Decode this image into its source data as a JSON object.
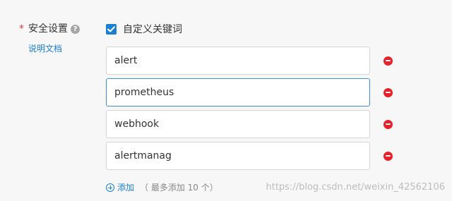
{
  "form": {
    "required_mark": "*",
    "label": "安全设置",
    "help_icon": "?",
    "doc_link": "说明文档",
    "checkbox": {
      "checked": true,
      "label": "自定义关键词"
    },
    "keywords": [
      {
        "value": "alert"
      },
      {
        "value": "prometheus"
      },
      {
        "value": "webhook"
      },
      {
        "value": "alertmanag"
      }
    ],
    "add_label": "添加",
    "add_hint": "（ 最多添加 10 个）"
  },
  "watermark": "https://blog.csdn.net/weixin_42562106",
  "colors": {
    "accent": "#1a7fd1",
    "remove": "#e8202a",
    "required": "#e03c3c"
  },
  "icons": {
    "help": "question-circle-icon",
    "checkbox": "check-icon",
    "remove": "minus-circle-icon",
    "add": "plus-circle-icon"
  }
}
